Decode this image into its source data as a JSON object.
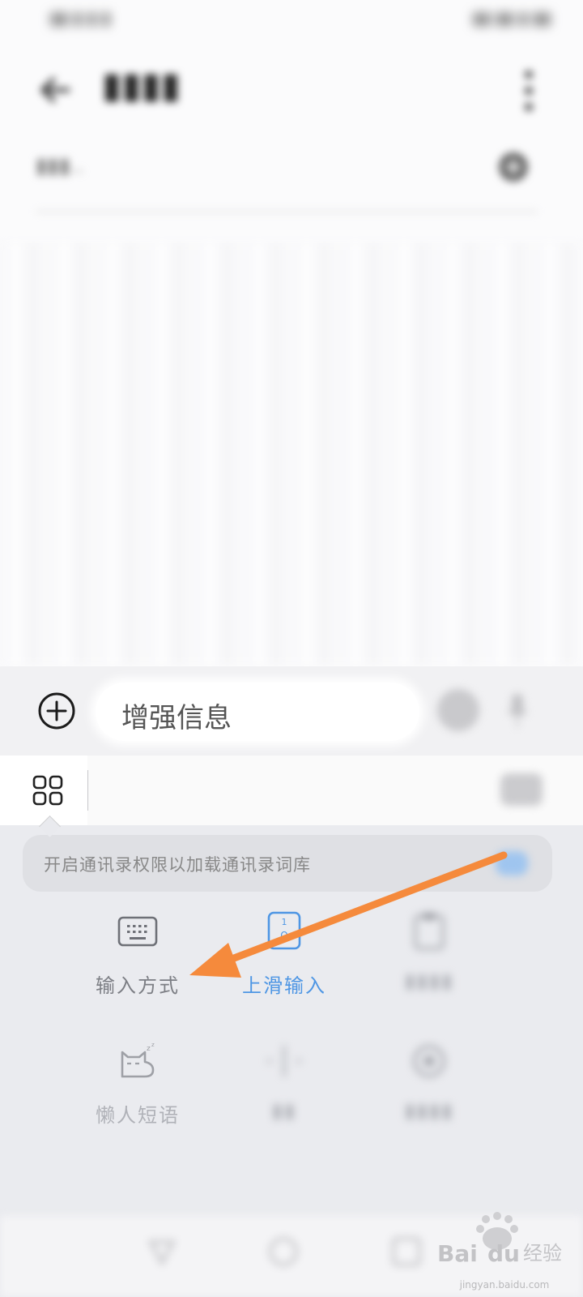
{
  "status_bar": {
    "left_text": "",
    "right_text": ""
  },
  "header": {
    "title": "",
    "recipient_placeholder": ""
  },
  "compose": {
    "input_text": "增强信息"
  },
  "keyboard": {
    "permission_tip": "开启通讯录权限以加载通讯录词库",
    "functions": [
      {
        "label": "输入方式",
        "icon": "keyboard-icon",
        "state": "normal"
      },
      {
        "label": "上滑输入",
        "icon": "swipe-up-key-icon",
        "state": "active"
      },
      {
        "label": "",
        "icon": "clipboard-icon",
        "state": "blurred"
      },
      {
        "label": "懒人短语",
        "icon": "sleeping-cat-icon",
        "state": "faded"
      },
      {
        "label": "",
        "icon": "cursor-edit-icon",
        "state": "blurred"
      },
      {
        "label": "",
        "icon": "settings-icon",
        "state": "blurred"
      }
    ]
  },
  "annotation": {
    "arrow_color": "#f58a3c",
    "points_to": "输入方式"
  },
  "watermark": {
    "logo_text": "Baidu经验",
    "url": "jingyan.baidu.com"
  },
  "colors": {
    "accent_blue": "#4e96e4",
    "panel_bg": "#eaebef",
    "arrow_orange": "#f58a3c"
  }
}
